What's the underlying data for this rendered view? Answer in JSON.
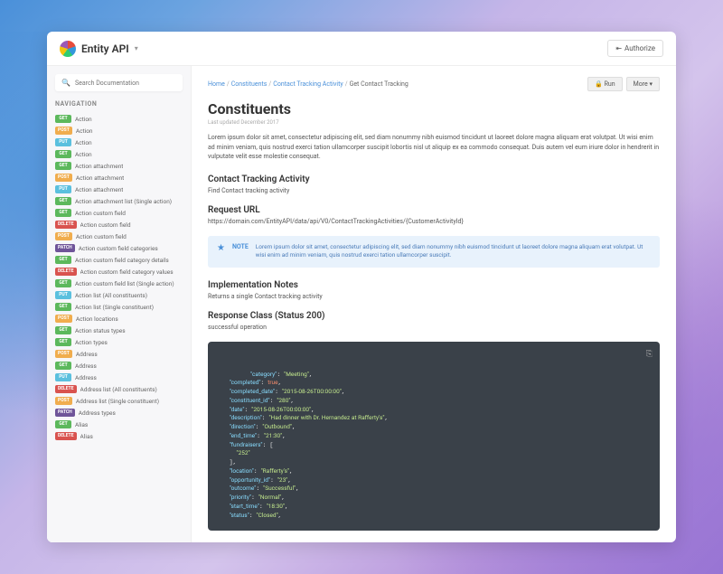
{
  "brand": {
    "name": "Entity API"
  },
  "auth_button": "Authorize",
  "search": {
    "placeholder": "Search Documentation"
  },
  "nav": {
    "title": "NAVIGATION",
    "items": [
      {
        "method": "GET",
        "label": "Action"
      },
      {
        "method": "POST",
        "label": "Action"
      },
      {
        "method": "PUT",
        "label": "Action"
      },
      {
        "method": "GET",
        "label": "Action"
      },
      {
        "method": "GET",
        "label": "Action attachment"
      },
      {
        "method": "POST",
        "label": "Action attachment"
      },
      {
        "method": "PUT",
        "label": "Action attachment"
      },
      {
        "method": "GET",
        "label": "Action attachment list (Single action)"
      },
      {
        "method": "GET",
        "label": "Action custom field"
      },
      {
        "method": "DELETE",
        "label": "Action custom field"
      },
      {
        "method": "POST",
        "label": "Action custom field"
      },
      {
        "method": "PATCH",
        "label": "Action custom field categories"
      },
      {
        "method": "GET",
        "label": "Action custom field category details"
      },
      {
        "method": "DELETE",
        "label": "Action custom field category values"
      },
      {
        "method": "GET",
        "label": "Action custom field list (Single action)"
      },
      {
        "method": "PUT",
        "label": "Action list (All constituents)"
      },
      {
        "method": "GET",
        "label": "Action list (Single constituent)"
      },
      {
        "method": "POST",
        "label": "Action locations"
      },
      {
        "method": "GET",
        "label": "Action status types"
      },
      {
        "method": "GET",
        "label": "Action types"
      },
      {
        "method": "POST",
        "label": "Address"
      },
      {
        "method": "GET",
        "label": "Address"
      },
      {
        "method": "PUT",
        "label": "Address"
      },
      {
        "method": "DELETE",
        "label": "Address list (All constituents)"
      },
      {
        "method": "POST",
        "label": "Address list (Single constituent)"
      },
      {
        "method": "PATCH",
        "label": "Address types"
      },
      {
        "method": "GET",
        "label": "Alias"
      },
      {
        "method": "DELETE",
        "label": "Alias"
      }
    ]
  },
  "breadcrumbs": [
    "Home",
    "Constituents",
    "Contact Tracking Activity",
    "Get Contact Tracking"
  ],
  "actions": {
    "run": "🔒 Run",
    "more": "More ▾"
  },
  "page": {
    "title": "Constituents",
    "updated": "Last updated December 2017",
    "intro": "Lorem ipsum dolor sit amet, consectetur adipiscing elit, sed diam nonummy nibh euismod tincidunt ut laoreet dolore magna aliquam erat volutpat. Ut wisi enim ad minim veniam, quis nostrud exerci tation ullamcorper suscipit lobortis nisl ut aliquip ex ea commodo consequat. Duis autem vel eum iriure dolor in hendrerit in vulputate velit esse molestie consequat.",
    "sections": {
      "activity": {
        "heading": "Contact Tracking Activity",
        "text": "Find Contact tracking activity"
      },
      "request_url": {
        "heading": "Request URL",
        "url": "https://domain.com/EntityAPI/data/api/V0/ContactTrackingActivities/{CustomerActivityId}"
      },
      "note": {
        "label": "NOTE",
        "text": "Lorem ipsum dolor sit amet, consectetur adipiscing elit, sed diam nonummy nibh euismod tincidunt ut laoreet dolore magna aliquam erat volutpat. Ut wisi enim ad minim veniam, quis nostrud exerci tation ullamcorper suscipit."
      },
      "impl": {
        "heading": "Implementation Notes",
        "text": "Returns a single Contact tracking activity"
      },
      "response": {
        "heading": "Response Class (Status 200)",
        "text": "successful operation"
      }
    }
  },
  "code": {
    "lines": [
      {
        "k": "category",
        "v": "Meeting",
        "t": "s"
      },
      {
        "k": "completed",
        "v": "true",
        "t": "b"
      },
      {
        "k": "completed_date",
        "v": "2015-08-26T00:00:00",
        "t": "s"
      },
      {
        "k": "constituent_id",
        "v": "280",
        "t": "s"
      },
      {
        "k": "date",
        "v": "2015-08-26T00:00:00",
        "t": "s"
      },
      {
        "k": "description",
        "v": "Had dinner with Dr. Hernandez at Rafferty's",
        "t": "s"
      },
      {
        "k": "direction",
        "v": "Outbound",
        "t": "s"
      },
      {
        "k": "end_time",
        "v": "21:30",
        "t": "s"
      },
      {
        "k": "fundraisers",
        "v": "[\"252\"]",
        "t": "a"
      },
      {
        "k": "location",
        "v": "Rafferty's",
        "t": "s"
      },
      {
        "k": "opportunity_id",
        "v": "23",
        "t": "s"
      },
      {
        "k": "outcome",
        "v": "Successful",
        "t": "s"
      },
      {
        "k": "priority",
        "v": "Normal",
        "t": "s"
      },
      {
        "k": "start_time",
        "v": "18:30",
        "t": "s"
      },
      {
        "k": "status",
        "v": "Closed",
        "t": "s"
      }
    ]
  }
}
